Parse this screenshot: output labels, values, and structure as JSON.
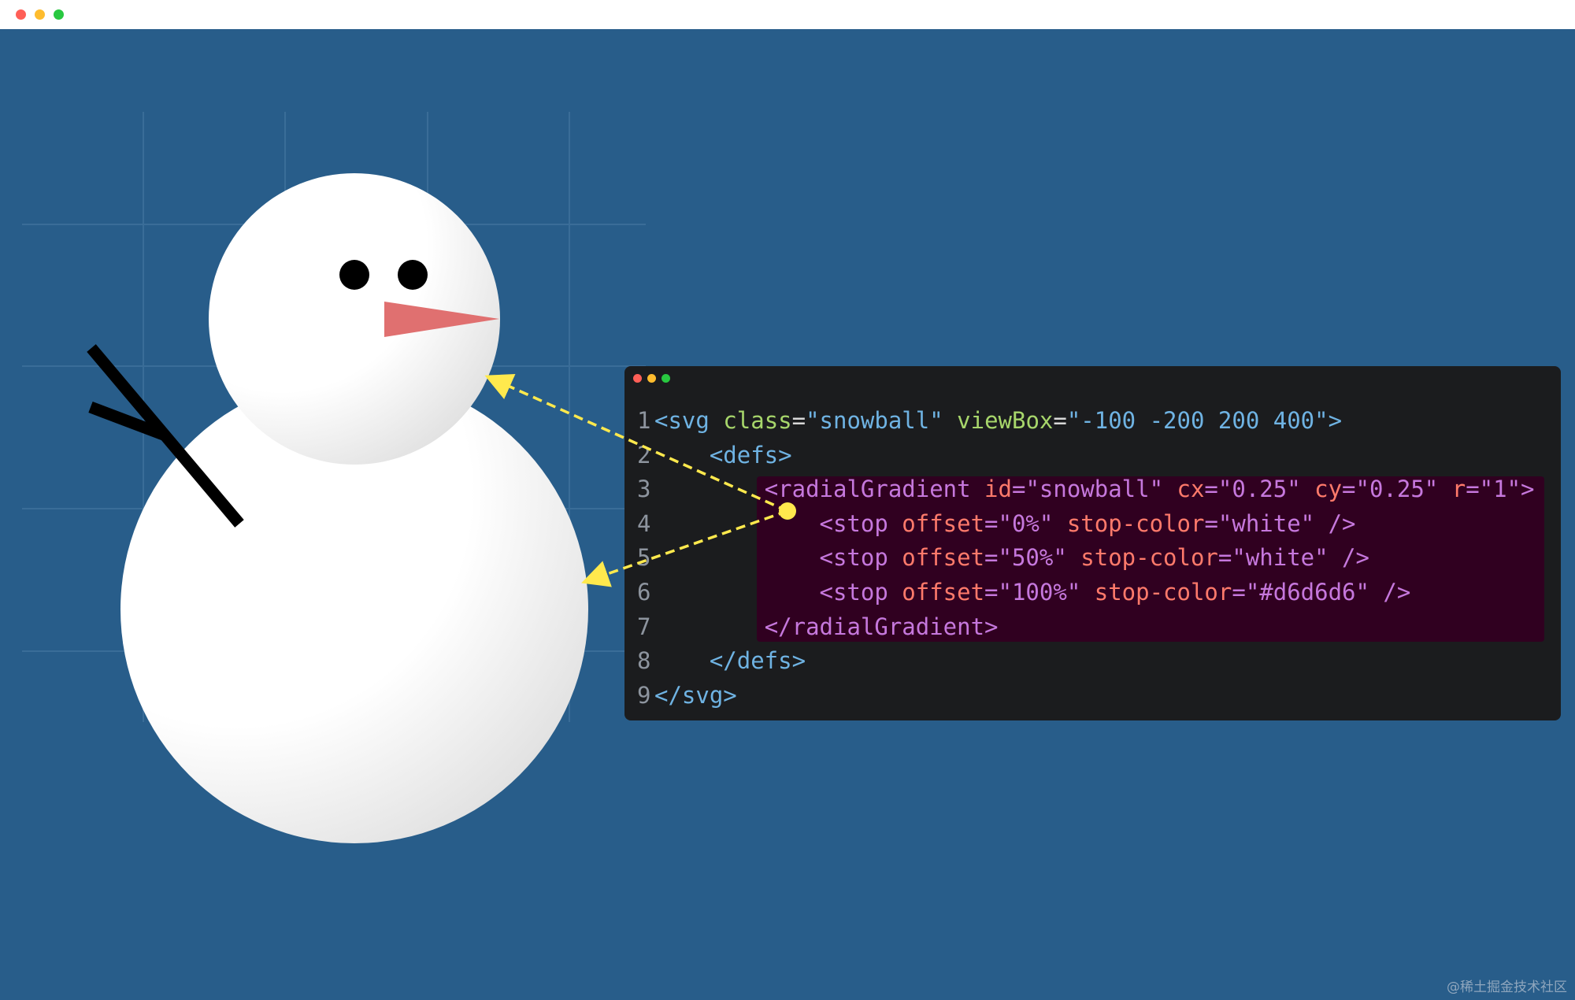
{
  "window": {
    "traffic_lights": [
      {
        "name": "close",
        "color": "#ff5f57"
      },
      {
        "name": "minimize",
        "color": "#febc2e"
      },
      {
        "name": "maximize",
        "color": "#28c840"
      }
    ]
  },
  "colors": {
    "background": "#285d8a",
    "grid_line": "#3a6d98",
    "snow_light": "#ffffff",
    "snow_shadow": "#d6d6d6",
    "eye": "#000000",
    "nose": "#e07070",
    "arm": "#000000",
    "arrow": "#ffe94d",
    "code_bg": "#1b1c1e",
    "highlight_bg": "#300020"
  },
  "code": {
    "lines": [
      {
        "n": "1",
        "indent": "",
        "parts": [
          {
            "t": "<svg ",
            "c": "tag"
          },
          {
            "t": "class",
            "c": "attr"
          },
          {
            "t": "=",
            "c": "plain"
          },
          {
            "t": "\"snowball\" ",
            "c": "val"
          },
          {
            "t": "viewBox",
            "c": "attr"
          },
          {
            "t": "=",
            "c": "plain"
          },
          {
            "t": "\"-100 -200 200 400\">",
            "c": "val"
          }
        ]
      },
      {
        "n": "2",
        "indent": "    ",
        "parts": [
          {
            "t": "<defs>",
            "c": "tag"
          }
        ]
      },
      {
        "n": "3",
        "indent": "        ",
        "parts": [
          {
            "t": "<radialGradient ",
            "c": "hl-tag"
          },
          {
            "t": "id",
            "c": "hl-attr"
          },
          {
            "t": "=",
            "c": "hl-tag"
          },
          {
            "t": "\"snowball\" ",
            "c": "hl-val"
          },
          {
            "t": "cx",
            "c": "hl-attr"
          },
          {
            "t": "=",
            "c": "hl-tag"
          },
          {
            "t": "\"0.25\" ",
            "c": "hl-val"
          },
          {
            "t": "cy",
            "c": "hl-attr"
          },
          {
            "t": "=",
            "c": "hl-tag"
          },
          {
            "t": "\"0.25\" ",
            "c": "hl-val"
          },
          {
            "t": "r",
            "c": "hl-attr"
          },
          {
            "t": "=",
            "c": "hl-tag"
          },
          {
            "t": "\"1\">",
            "c": "hl-val"
          }
        ]
      },
      {
        "n": "4",
        "indent": "            ",
        "parts": [
          {
            "t": "<stop ",
            "c": "hl-tag"
          },
          {
            "t": "offset",
            "c": "hl-attr"
          },
          {
            "t": "=",
            "c": "hl-tag"
          },
          {
            "t": "\"0%\" ",
            "c": "hl-val"
          },
          {
            "t": "stop-color",
            "c": "hl-attr"
          },
          {
            "t": "=",
            "c": "hl-tag"
          },
          {
            "t": "\"white\" ",
            "c": "hl-val"
          },
          {
            "t": "/>",
            "c": "hl-tag"
          }
        ]
      },
      {
        "n": "5",
        "indent": "            ",
        "parts": [
          {
            "t": "<stop ",
            "c": "hl-tag"
          },
          {
            "t": "offset",
            "c": "hl-attr"
          },
          {
            "t": "=",
            "c": "hl-tag"
          },
          {
            "t": "\"50%\" ",
            "c": "hl-val"
          },
          {
            "t": "stop-color",
            "c": "hl-attr"
          },
          {
            "t": "=",
            "c": "hl-tag"
          },
          {
            "t": "\"white\" ",
            "c": "hl-val"
          },
          {
            "t": "/>",
            "c": "hl-tag"
          }
        ]
      },
      {
        "n": "6",
        "indent": "            ",
        "parts": [
          {
            "t": "<stop ",
            "c": "hl-tag"
          },
          {
            "t": "offset",
            "c": "hl-attr"
          },
          {
            "t": "=",
            "c": "hl-tag"
          },
          {
            "t": "\"100%\" ",
            "c": "hl-val"
          },
          {
            "t": "stop-color",
            "c": "hl-attr"
          },
          {
            "t": "=",
            "c": "hl-tag"
          },
          {
            "t": "\"#d6d6d6\" ",
            "c": "hl-val"
          },
          {
            "t": "/>",
            "c": "hl-tag"
          }
        ]
      },
      {
        "n": "7",
        "indent": "        ",
        "parts": [
          {
            "t": "</radialGradient>",
            "c": "hl-tag"
          }
        ]
      },
      {
        "n": "8",
        "indent": "    ",
        "parts": [
          {
            "t": "</defs>",
            "c": "tag"
          }
        ]
      },
      {
        "n": "9",
        "indent": "",
        "parts": [
          {
            "t": "</svg>",
            "c": "tag"
          }
        ]
      }
    ]
  },
  "watermark": "@稀土掘金技术社区"
}
